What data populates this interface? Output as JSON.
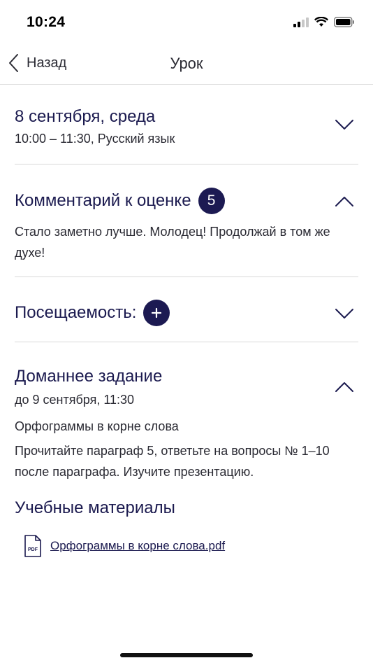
{
  "status": {
    "time": "10:24"
  },
  "nav": {
    "back_label": "Назад",
    "title": "Урок"
  },
  "lesson": {
    "date": "8 сентября, среда",
    "details": "10:00 – 11:30, Русский язык"
  },
  "grade_comment": {
    "title": "Комментарий к оценке",
    "grade": "5",
    "text": "Стало заметно лучше. Молодец! Продолжай в том же духе!"
  },
  "attendance": {
    "title": "Посещаемость:"
  },
  "homework": {
    "title": "Доманнее задание",
    "due": "до 9 сентября, 11:30",
    "topic": "Орфограммы в корне слова",
    "text": "Прочитайте параграф 5, ответьте на вопросы № 1–10 после параграфа. Изучите презентацию."
  },
  "materials": {
    "title": "Учебные материалы",
    "file_name": "Орфограммы в корне слова.pdf",
    "file_icon_label": "PDF"
  },
  "icons": {
    "back": "chevron-left-icon",
    "expand": "chevron-down-icon",
    "collapse": "chevron-up-icon",
    "add": "plus-icon",
    "file": "pdf-file-icon"
  },
  "colors": {
    "accent": "#1c1a52",
    "text": "#1b1a4f",
    "divider": "#d8d8d8"
  }
}
